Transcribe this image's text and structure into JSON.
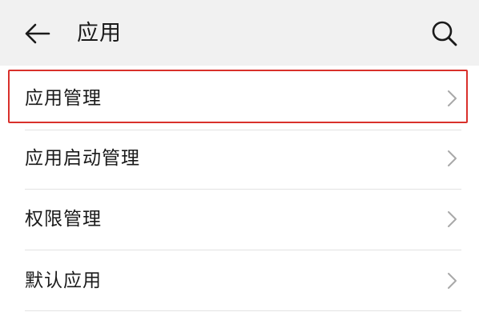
{
  "header": {
    "title": "应用",
    "back_icon": "arrow-left-icon",
    "search_icon": "search-icon"
  },
  "list": {
    "items": [
      {
        "label": "应用管理",
        "icon": "chevron-right-icon",
        "highlighted": true
      },
      {
        "label": "应用启动管理",
        "icon": "chevron-right-icon",
        "highlighted": false
      },
      {
        "label": "权限管理",
        "icon": "chevron-right-icon",
        "highlighted": false
      },
      {
        "label": "默认应用",
        "icon": "chevron-right-icon",
        "highlighted": false
      }
    ]
  },
  "colors": {
    "header_background": "#f1f1f1",
    "highlight_border": "#d9302b",
    "text": "#1a1a1a",
    "chevron": "#a8a8a8",
    "divider": "#e3e3e3"
  }
}
